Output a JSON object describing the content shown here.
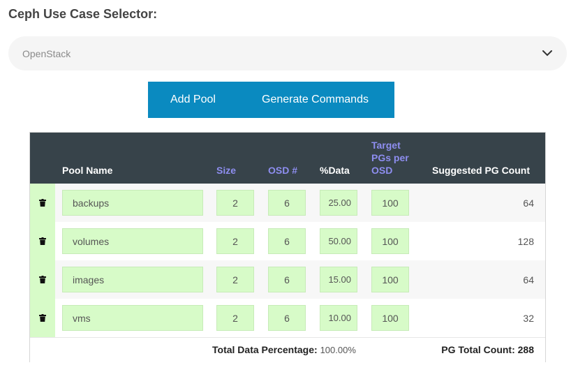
{
  "selector": {
    "title": "Ceph Use Case Selector:",
    "value": "OpenStack"
  },
  "buttons": {
    "add_pool": "Add Pool",
    "generate_commands": "Generate Commands"
  },
  "table": {
    "headers": {
      "pool_name": "Pool Name",
      "size": "Size",
      "osd": "OSD #",
      "data": "%Data",
      "target_line1": "Target",
      "target_line2": "PGs per",
      "target_line3": "OSD",
      "suggested": "Suggested PG Count"
    },
    "rows": [
      {
        "name": "backups",
        "size": "2",
        "osd": "6",
        "data": "25.00",
        "target": "100",
        "pg": "64"
      },
      {
        "name": "volumes",
        "size": "2",
        "osd": "6",
        "data": "50.00",
        "target": "100",
        "pg": "128"
      },
      {
        "name": "images",
        "size": "2",
        "osd": "6",
        "data": "15.00",
        "target": "100",
        "pg": "64"
      },
      {
        "name": "vms",
        "size": "2",
        "osd": "6",
        "data": "10.00",
        "target": "100",
        "pg": "32"
      }
    ],
    "footer": {
      "total_data_label": "Total Data Percentage:",
      "total_data_value": "100.00%",
      "pg_total_label": "PG Total Count:",
      "pg_total_value": "288"
    }
  },
  "colors": {
    "button_bg": "#0a8ac0",
    "header_bg": "#37434a",
    "header_link": "#8e8ef0",
    "input_bg": "#d7fbc8"
  },
  "icons": {
    "row_delete": "trash-icon",
    "selector_toggle": "chevron-down-icon"
  }
}
